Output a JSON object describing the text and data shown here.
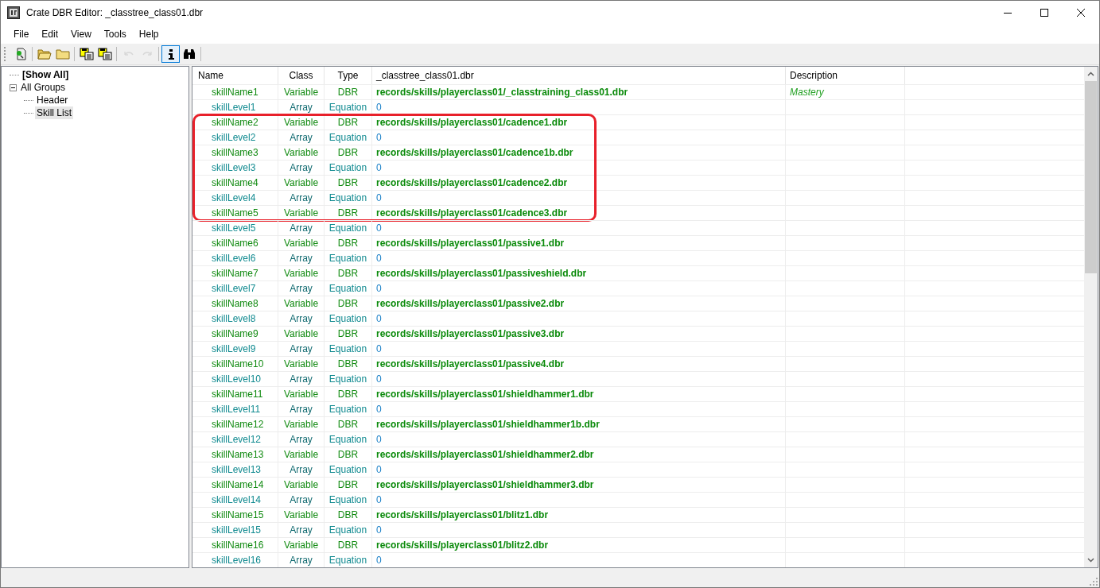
{
  "window": {
    "title": "Crate DBR Editor: _classtree_class01.dbr"
  },
  "menu": [
    "File",
    "Edit",
    "View",
    "Tools",
    "Help"
  ],
  "toolbar": [
    {
      "kind": "import",
      "disabled": false,
      "selected": false
    },
    {
      "kind": "separator"
    },
    {
      "kind": "open-folder",
      "disabled": false,
      "selected": false
    },
    {
      "kind": "folder",
      "disabled": false,
      "selected": false
    },
    {
      "kind": "separator"
    },
    {
      "kind": "save-as",
      "disabled": false,
      "selected": false
    },
    {
      "kind": "save-all",
      "disabled": false,
      "selected": false
    },
    {
      "kind": "separator"
    },
    {
      "kind": "undo",
      "disabled": true,
      "selected": false
    },
    {
      "kind": "redo",
      "disabled": true,
      "selected": false
    },
    {
      "kind": "separator"
    },
    {
      "kind": "info",
      "disabled": false,
      "selected": true
    },
    {
      "kind": "find",
      "disabled": false,
      "selected": false
    },
    {
      "kind": "separator"
    }
  ],
  "tree": [
    {
      "label": "[Show All]",
      "bold": true,
      "selected": false
    },
    {
      "label": "All Groups",
      "bold": false,
      "selected": false,
      "expanded": true,
      "children": [
        {
          "label": "Header",
          "bold": false,
          "selected": false
        },
        {
          "label": "Skill List",
          "bold": false,
          "selected": true
        }
      ]
    }
  ],
  "table": {
    "columns": [
      "Name",
      "Class",
      "Type",
      "_classtree_class01.dbr",
      "Description"
    ],
    "rows": [
      {
        "kind": "variable",
        "name": "skillName1",
        "class": "Variable",
        "type": "DBR",
        "value": "records/skills/playerclass01/_classtraining_class01.dbr",
        "description": "Mastery",
        "highlighted": false
      },
      {
        "kind": "array",
        "name": "skillLevel1",
        "class": "Array",
        "type": "Equation",
        "value": "0",
        "highlighted": false
      },
      {
        "kind": "variable",
        "name": "skillName2",
        "class": "Variable",
        "type": "DBR",
        "value": "records/skills/playerclass01/cadence1.dbr",
        "highlighted": true
      },
      {
        "kind": "array",
        "name": "skillLevel2",
        "class": "Array",
        "type": "Equation",
        "value": "0",
        "highlighted": true
      },
      {
        "kind": "variable",
        "name": "skillName3",
        "class": "Variable",
        "type": "DBR",
        "value": "records/skills/playerclass01/cadence1b.dbr",
        "highlighted": true
      },
      {
        "kind": "array",
        "name": "skillLevel3",
        "class": "Array",
        "type": "Equation",
        "value": "0",
        "highlighted": true
      },
      {
        "kind": "variable",
        "name": "skillName4",
        "class": "Variable",
        "type": "DBR",
        "value": "records/skills/playerclass01/cadence2.dbr",
        "highlighted": true
      },
      {
        "kind": "array",
        "name": "skillLevel4",
        "class": "Array",
        "type": "Equation",
        "value": "0",
        "highlighted": true
      },
      {
        "kind": "variable",
        "name": "skillName5",
        "class": "Variable",
        "type": "DBR",
        "value": "records/skills/playerclass01/cadence3.dbr",
        "highlighted": true
      },
      {
        "kind": "array",
        "name": "skillLevel5",
        "class": "Array",
        "type": "Equation",
        "value": "0",
        "highlighted": false
      },
      {
        "kind": "variable",
        "name": "skillName6",
        "class": "Variable",
        "type": "DBR",
        "value": "records/skills/playerclass01/passive1.dbr",
        "highlighted": false
      },
      {
        "kind": "array",
        "name": "skillLevel6",
        "class": "Array",
        "type": "Equation",
        "value": "0",
        "highlighted": false
      },
      {
        "kind": "variable",
        "name": "skillName7",
        "class": "Variable",
        "type": "DBR",
        "value": "records/skills/playerclass01/passiveshield.dbr",
        "highlighted": false
      },
      {
        "kind": "array",
        "name": "skillLevel7",
        "class": "Array",
        "type": "Equation",
        "value": "0",
        "highlighted": false
      },
      {
        "kind": "variable",
        "name": "skillName8",
        "class": "Variable",
        "type": "DBR",
        "value": "records/skills/playerclass01/passive2.dbr",
        "highlighted": false
      },
      {
        "kind": "array",
        "name": "skillLevel8",
        "class": "Array",
        "type": "Equation",
        "value": "0",
        "highlighted": false
      },
      {
        "kind": "variable",
        "name": "skillName9",
        "class": "Variable",
        "type": "DBR",
        "value": "records/skills/playerclass01/passive3.dbr",
        "highlighted": false
      },
      {
        "kind": "array",
        "name": "skillLevel9",
        "class": "Array",
        "type": "Equation",
        "value": "0",
        "highlighted": false
      },
      {
        "kind": "variable",
        "name": "skillName10",
        "class": "Variable",
        "type": "DBR",
        "value": "records/skills/playerclass01/passive4.dbr",
        "highlighted": false
      },
      {
        "kind": "array",
        "name": "skillLevel10",
        "class": "Array",
        "type": "Equation",
        "value": "0",
        "highlighted": false
      },
      {
        "kind": "variable",
        "name": "skillName11",
        "class": "Variable",
        "type": "DBR",
        "value": "records/skills/playerclass01/shieldhammer1.dbr",
        "highlighted": false
      },
      {
        "kind": "array",
        "name": "skillLevel11",
        "class": "Array",
        "type": "Equation",
        "value": "0",
        "highlighted": false
      },
      {
        "kind": "variable",
        "name": "skillName12",
        "class": "Variable",
        "type": "DBR",
        "value": "records/skills/playerclass01/shieldhammer1b.dbr",
        "highlighted": false
      },
      {
        "kind": "array",
        "name": "skillLevel12",
        "class": "Array",
        "type": "Equation",
        "value": "0",
        "highlighted": false
      },
      {
        "kind": "variable",
        "name": "skillName13",
        "class": "Variable",
        "type": "DBR",
        "value": "records/skills/playerclass01/shieldhammer2.dbr",
        "highlighted": false
      },
      {
        "kind": "array",
        "name": "skillLevel13",
        "class": "Array",
        "type": "Equation",
        "value": "0",
        "highlighted": false
      },
      {
        "kind": "variable",
        "name": "skillName14",
        "class": "Variable",
        "type": "DBR",
        "value": "records/skills/playerclass01/shieldhammer3.dbr",
        "highlighted": false
      },
      {
        "kind": "array",
        "name": "skillLevel14",
        "class": "Array",
        "type": "Equation",
        "value": "0",
        "highlighted": false
      },
      {
        "kind": "variable",
        "name": "skillName15",
        "class": "Variable",
        "type": "DBR",
        "value": "records/skills/playerclass01/blitz1.dbr",
        "highlighted": false
      },
      {
        "kind": "array",
        "name": "skillLevel15",
        "class": "Array",
        "type": "Equation",
        "value": "0",
        "highlighted": false
      },
      {
        "kind": "variable",
        "name": "skillName16",
        "class": "Variable",
        "type": "DBR",
        "value": "records/skills/playerclass01/blitz2.dbr",
        "highlighted": false
      },
      {
        "kind": "array",
        "name": "skillLevel16",
        "class": "Array",
        "type": "Equation",
        "value": "0",
        "highlighted": false
      }
    ]
  }
}
